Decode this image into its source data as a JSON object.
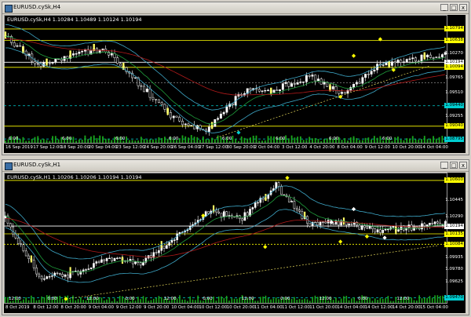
{
  "windows": [
    {
      "id": "h4",
      "title": "EURUSD.cySk,H4",
      "label": "EURUSD.cySk,H4   1.10284 1.10489 1.10124 1.10194",
      "buttons": [
        "_",
        "□",
        "x"
      ],
      "price_ticks": [
        "1.10794",
        "1.10638",
        "1.10270",
        "1.10194",
        "1.10094",
        "1.09765",
        "1.09510",
        "1.09440",
        "1.09255",
        "1.09040",
        "1.08795"
      ],
      "price_colors": [
        "#ffff00",
        "#ffff00",
        "#000000",
        "#ffffff",
        "#ffff00",
        "#000000",
        "#000000",
        "#00ced1",
        "#000000",
        "#ffff00",
        "#00ced1"
      ],
      "time_labels": [
        "16 Sep 2019",
        "17 Sep 12:00",
        "18 Sep 20:00",
        "20 Sep 04:00",
        "23 Sep 12:00",
        "24 Sep 20:00",
        "26 Sep 04:00",
        "27 Sep 12:00",
        "30 Sep 20:00",
        "2 Oct 04:00",
        "3 Oct 12:00",
        "4 Oct 20:00",
        "8 Oct 04:00",
        "9 Oct 12:00",
        "10 Oct 20:00",
        "14 Oct 04:00"
      ],
      "hour_labels": [
        "6:00",
        "6:00",
        "6:00",
        "6:00",
        "6:00",
        "6:00",
        "6:00",
        "6:00"
      ]
    },
    {
      "id": "h1",
      "title": "EURUSD.cySk,H1",
      "label": "EURUSD.cySk,H1   1.10206 1.10206 1.10194 1.10194",
      "buttons": [
        "_",
        "□",
        "x"
      ],
      "price_ticks": [
        "1.10600",
        "1.10445",
        "1.10290",
        "1.10194",
        "1.10135",
        "1.10084",
        "1.09935",
        "1.09780",
        "1.09625",
        "1.09470"
      ],
      "price_colors": [
        "#ffff00",
        "#000000",
        "#000000",
        "#ffffff",
        "#ffff00",
        "#ffff00",
        "#000000",
        "#000000",
        "#000000",
        "#00ced1"
      ],
      "time_labels": [
        "8 Oct 2019",
        "8 Oct 12:00",
        "8 Oct 20:00",
        "9 Oct 04:00",
        "9 Oct 12:00",
        "9 Oct 20:00",
        "10 Oct 04:00",
        "10 Oct 12:00",
        "10 Oct 20:00",
        "11 Oct 04:00",
        "11 Oct 12:00",
        "11 Oct 20:00",
        "14 Oct 04:00",
        "14 Oct 12:00",
        "14 Oct 20:00",
        "15 Oct 04:00"
      ],
      "hour_labels": [
        "12:00",
        "0:00",
        "12:00",
        "0:00",
        "12:00",
        "0:00",
        "12:00",
        "0:00",
        "12:00",
        "0:00",
        "12:00"
      ]
    }
  ]
}
